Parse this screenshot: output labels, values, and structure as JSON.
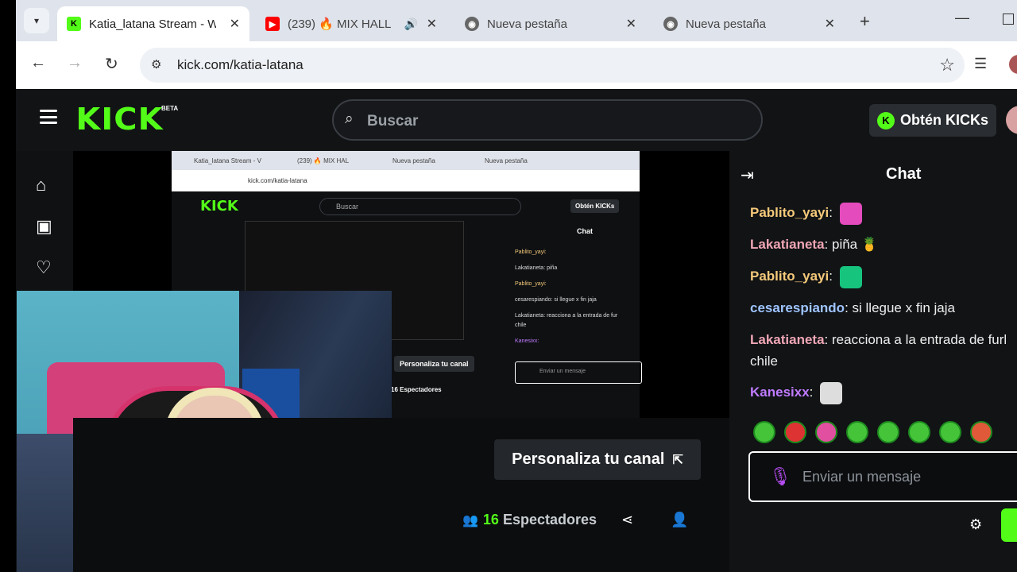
{
  "browser": {
    "tabs": [
      {
        "title": "Katia_latana Stream - W",
        "active": true,
        "favicon": "kick-favicon"
      },
      {
        "title": "(239) 🔥 MIX HALL",
        "active": false,
        "favicon": "youtube-favicon"
      },
      {
        "title": "Nueva pestaña",
        "active": false,
        "favicon": "chrome-favicon"
      },
      {
        "title": "Nueva pestaña",
        "active": false,
        "favicon": "chrome-favicon"
      }
    ],
    "url": "kick.com/katia-latana"
  },
  "kick": {
    "logo": "KICK",
    "beta": "BETA",
    "search_placeholder": "Buscar",
    "kicks_button": "Obtén KICKs",
    "personaliza_label": "Personaliza tu canal",
    "viewers_count": "16",
    "viewers_label": "Espectadores"
  },
  "chat": {
    "title": "Chat",
    "messages": [
      {
        "user": "Pablito_yayi",
        "text": "",
        "color": "#f5c97a"
      },
      {
        "user": "Lakatianeta",
        "text": "piña 🍍",
        "color": "#f0a6b5"
      },
      {
        "user": "Pablito_yayi",
        "text": "",
        "color": "#f5c97a"
      },
      {
        "user": "cesarespiando",
        "text": "si llegue x fin jaja",
        "color": "#9fc4ff"
      },
      {
        "user": "Lakatianeta",
        "text": "reacciona a la entrada de furl chile",
        "color": "#f0a6b5"
      },
      {
        "user": "Kanesixx",
        "text": "",
        "color": "#c07bff"
      }
    ],
    "input_placeholder": "Enviar un mensaje"
  },
  "nested": {
    "tab1": "Katia_latana Stream - V",
    "tab2": "(239) 🔥 MIX HAL",
    "tab3": "Nueva pestaña",
    "tab4": "Nueva pestaña",
    "url": "kick.com/katia-latana",
    "search": "Buscar",
    "kicks": "Obtén KICKs",
    "chat_title": "Chat",
    "msg1": "Pablito_yayi:",
    "msg2": "Lakatianeta: piña",
    "msg3": "Pablito_yayi:",
    "msg4": "cesarespiando: si llegue x fin jaja",
    "msg5": "Lakatianeta: reacciona a la entrada de fur",
    "msg5b": "chile",
    "msg6": "Kanesixx:",
    "personaliza": "Personaliza tu canal",
    "viewers": "16 Espectadores",
    "input": "Enviar un mensaje"
  }
}
